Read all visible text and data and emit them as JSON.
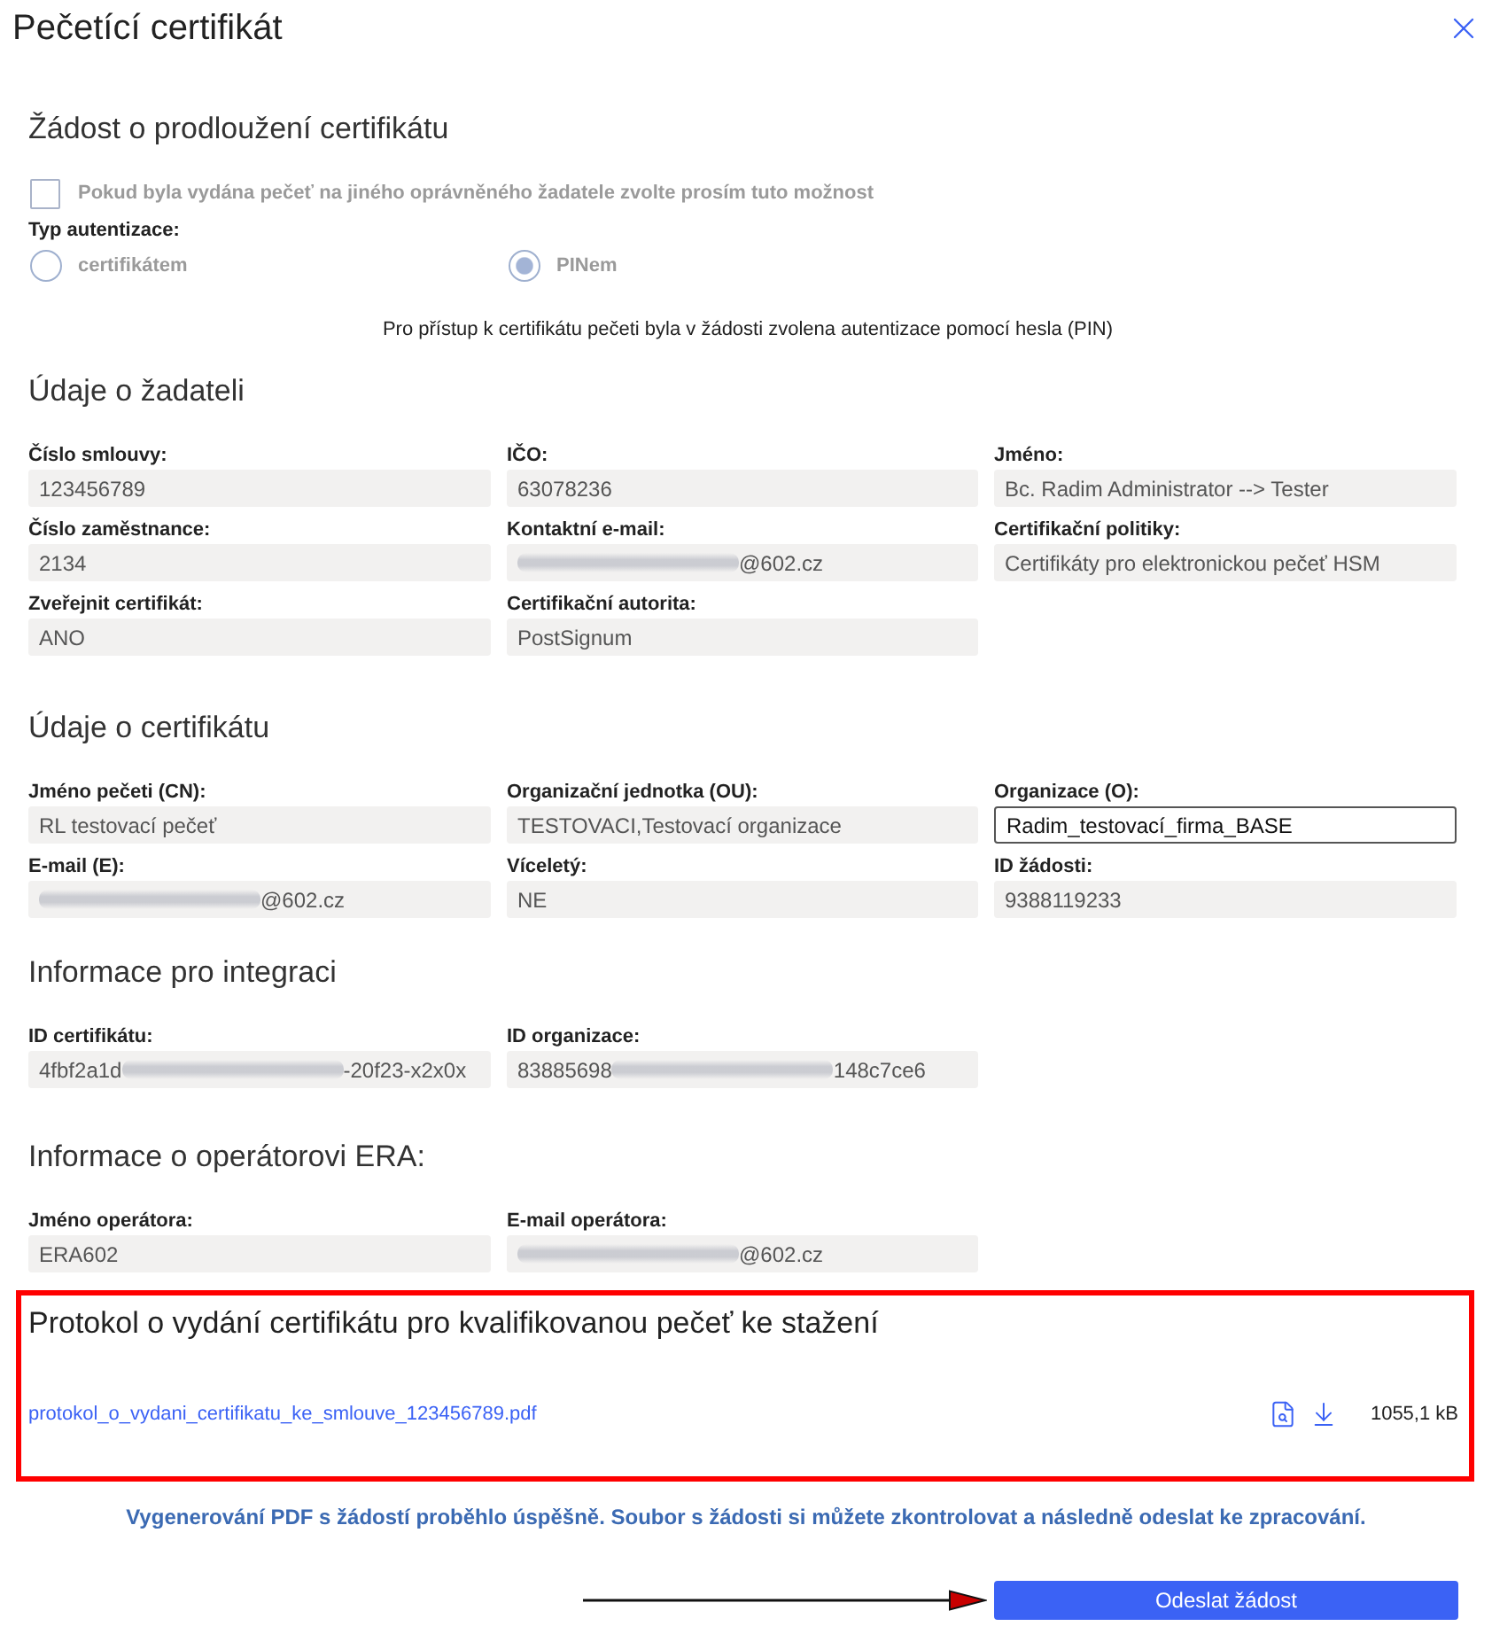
{
  "dialog": {
    "title": "Pečetící certifikát"
  },
  "renewal": {
    "heading": "Žádost o prodloužení certifikátu",
    "checkbox": {
      "label": "Pokud byla vydána pečeť na jiného oprávněného žadatele zvolte prosím tuto možnost",
      "checked": false,
      "disabled": true
    },
    "auth_label": "Typ autentizace:",
    "auth_options": [
      {
        "label": "certifikátem",
        "selected": false,
        "disabled": true
      },
      {
        "label": "PINem",
        "selected": true,
        "disabled": true
      }
    ],
    "note": "Pro přístup k certifikátu pečeti byla v žádosti zvolena autentizace pomocí hesla (PIN)"
  },
  "sections": [
    {
      "heading": "Údaje o žadateli",
      "fields": [
        {
          "label": "Číslo smlouvy:",
          "kind": "readonly",
          "value": "123456789"
        },
        {
          "label": "IČO:",
          "kind": "readonly",
          "value": "63078236"
        },
        {
          "label": "Jméno:",
          "kind": "readonly",
          "value": "Bc. Radim Administrator --> Tester"
        },
        {
          "label": "Číslo zaměstnance:",
          "kind": "readonly",
          "value": "2134"
        },
        {
          "label": "Kontaktní e-mail:",
          "kind": "readonly",
          "redacted": true,
          "value_after": "@602.cz"
        },
        {
          "label": "Certifikační politiky:",
          "kind": "readonly",
          "value": "Certifikáty pro elektronickou pečeť HSM"
        },
        {
          "label": "Zveřejnit certifikát:",
          "kind": "readonly",
          "value": "ANO"
        },
        {
          "label": "Certifikační autorita:",
          "kind": "readonly",
          "value": "PostSignum"
        }
      ]
    },
    {
      "heading": "Údaje o certifikátu",
      "fields": [
        {
          "label": "Jméno pečeti (CN):",
          "kind": "readonly",
          "value": "RL testovací pečeť"
        },
        {
          "label": "Organizační jednotka (OU):",
          "kind": "readonly",
          "value": "TESTOVACI,Testovací organizace"
        },
        {
          "label": "Organizace (O):",
          "kind": "input",
          "value": "Radim_testovací_firma_BASE"
        },
        {
          "label": "E-mail (E):",
          "kind": "readonly",
          "redacted": true,
          "value_after": "@602.cz"
        },
        {
          "label": "Víceletý:",
          "kind": "readonly",
          "value": "NE"
        },
        {
          "label": "ID žádosti:",
          "kind": "readonly",
          "value": "9388119233"
        }
      ]
    },
    {
      "heading": "Informace pro integraci",
      "fields": [
        {
          "label": "ID certifikátu:",
          "kind": "readonly",
          "value": "4fbf2a1d",
          "redacted": true,
          "value_after": "-20f23-x2x0x"
        },
        {
          "label": "ID organizace:",
          "kind": "readonly",
          "value": "83885698",
          "redacted": true,
          "value_after": "148c7ce6"
        }
      ]
    },
    {
      "heading": "Informace o operátorovi ERA:",
      "fields": [
        {
          "label": "Jméno operátora:",
          "kind": "readonly",
          "value": "ERA602"
        },
        {
          "label": "E-mail operátora:",
          "kind": "readonly",
          "redacted": true,
          "value_after": "@602.cz"
        }
      ]
    }
  ],
  "download": {
    "heading": "Protokol o vydání certifikátu pro kvalifikovanou pečeť ke stažení",
    "file": {
      "name": "protokol_o_vydani_certifikatu_ke_smlouve_123456789.pdf",
      "size": "1055,1 kB"
    }
  },
  "status_message": "Vygenerování PDF s žádostí proběhlo úspěšně. Soubor s žádosti si můžete zkontrolovat a následně odeslat ke zpracování.",
  "submit_button": "Odeslat žádost"
}
